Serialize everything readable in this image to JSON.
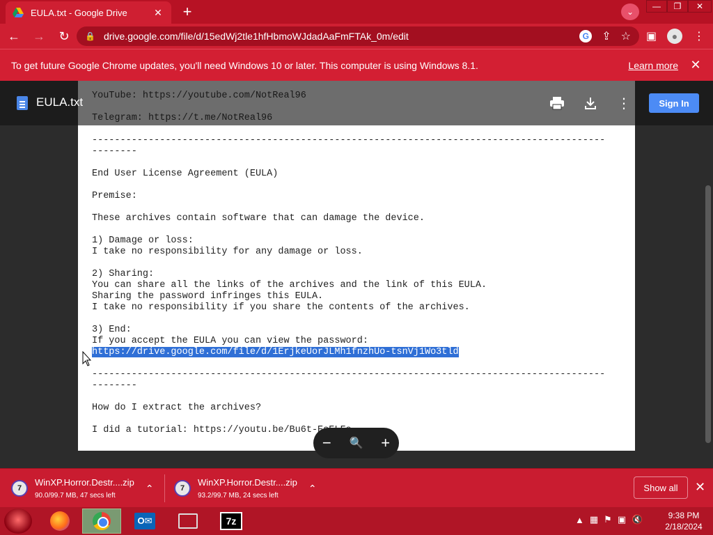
{
  "browser": {
    "tab": {
      "title": "EULA.txt - Google Drive",
      "favicon": "google-drive-icon"
    },
    "address": "drive.google.com/file/d/15edWj2tle1hfHbmoWJdadAaFmFTAk_0m/edit"
  },
  "infobar": {
    "message": "To get future Google Chrome updates, you'll need Windows 10 or later. This computer is using Windows 8.1.",
    "learn_more": "Learn more"
  },
  "drive": {
    "filename": "EULA.txt",
    "sign_in": "Sign In"
  },
  "document": {
    "lines_before": [
      "YouTube: https://youtube.com/NotReal96",
      "",
      "Telegram: https://t.me/NotReal96",
      "",
      "-------------------------------------------------------------------------------------------",
      "--------",
      "",
      "End User License Agreement (EULA)",
      "",
      "Premise:",
      "",
      "These archives contain software that can damage the device.",
      "",
      "1) Damage or loss:",
      "I take no responsibility for any damage or loss.",
      "",
      "2) Sharing:",
      "You can share all the links of the archives and the link of this EULA.",
      "Sharing the password infringes this EULA.",
      "I take no responsibility if you share the contents of the archives.",
      "",
      "3) End:",
      "If you accept the EULA you can view the password:"
    ],
    "selected_link": "https://drive.google.com/file/d/1ErjkeUorJLMh1fnzhUo-tsnVj1Wo3tld",
    "lines_after": [
      "",
      "-------------------------------------------------------------------------------------------",
      "--------",
      "",
      "How do I extract the archives?",
      "",
      "I did a tutorial: https://youtu.be/Bu6t-EoELFs"
    ]
  },
  "downloads": [
    {
      "filename": "WinXP.Horror.Destr....zip",
      "status": "90.0/99.7 MB, 47 secs left"
    },
    {
      "filename": "WinXP.Horror.Destr....zip",
      "status": "93.2/99.7 MB, 24 secs left"
    }
  ],
  "shelf": {
    "show_all": "Show all"
  },
  "taskbar": {
    "time": "9:38 PM",
    "date": "2/18/2024"
  }
}
